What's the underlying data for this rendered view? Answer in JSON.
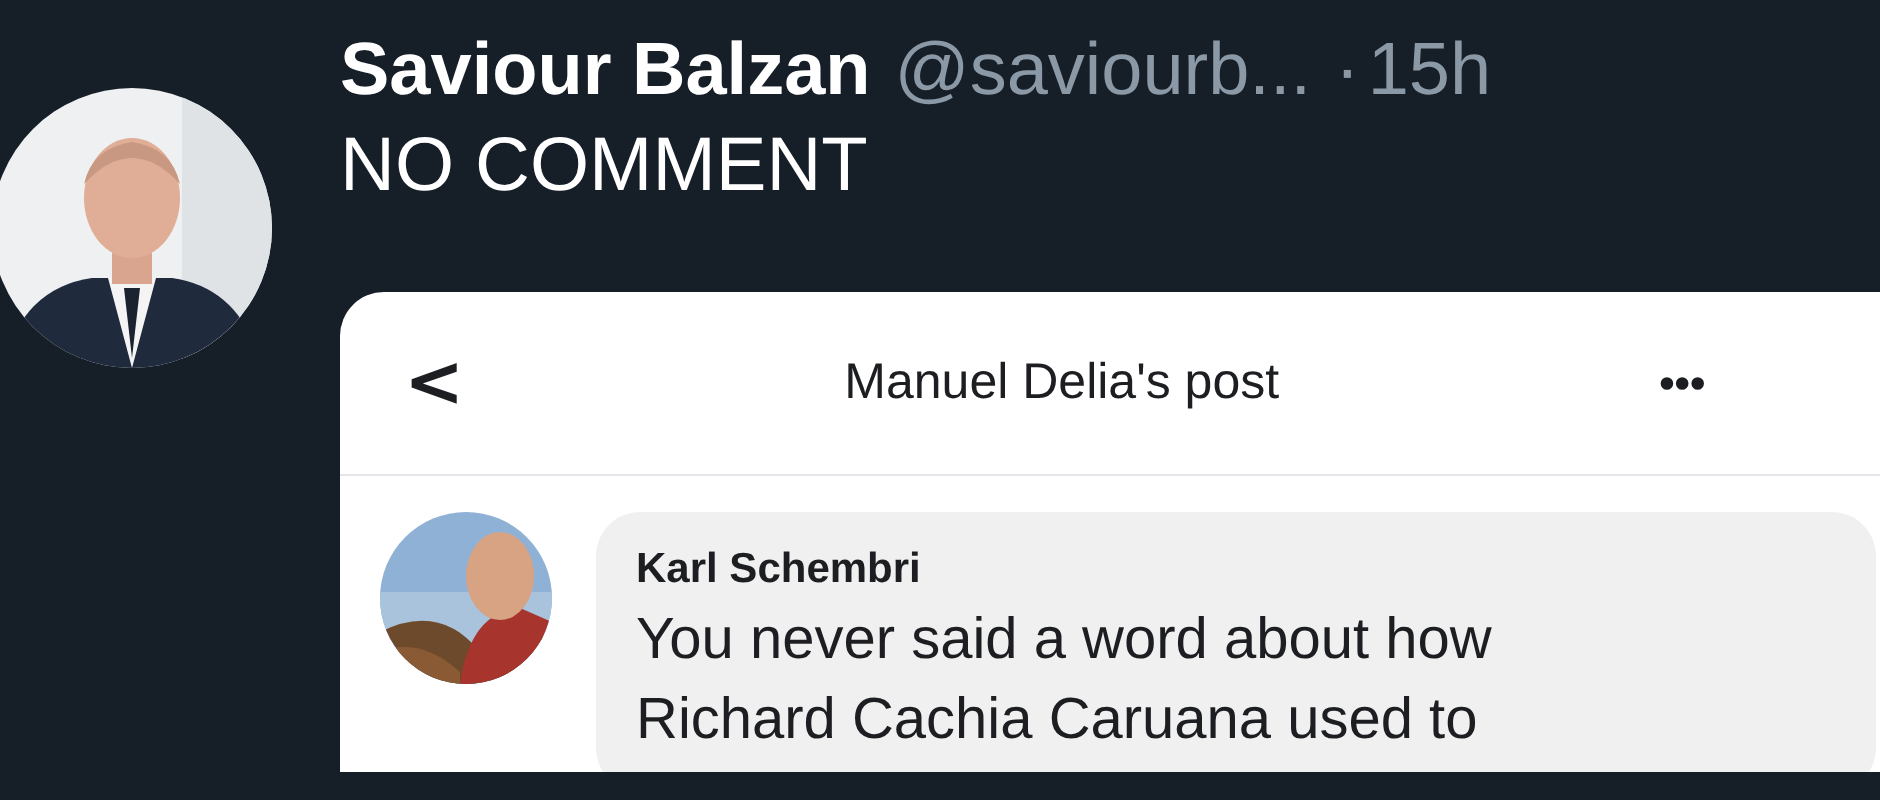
{
  "tweet": {
    "author": "Saviour Balzan",
    "handle": "@saviourb...",
    "separator": "·",
    "time": "15h",
    "text": "NO COMMENT"
  },
  "embedded_post": {
    "header": {
      "back": "<",
      "title": "Manuel Delia's post",
      "more": "•••"
    },
    "comment": {
      "author": "Karl Schembri",
      "lines": [
        "You never said a word about how",
        "Richard Cachia Caruana used to"
      ]
    }
  }
}
